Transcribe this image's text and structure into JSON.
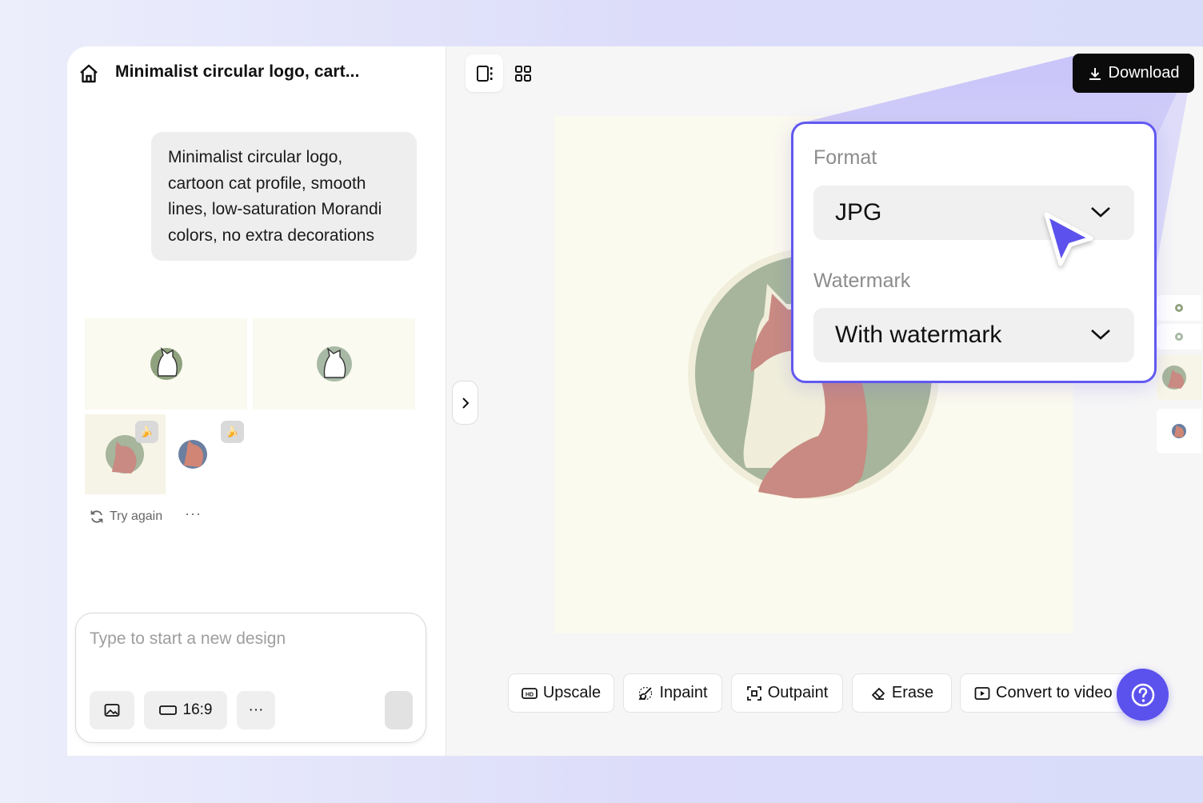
{
  "header": {
    "title": "Minimalist circular logo, cart..."
  },
  "chat": {
    "prompt": "Minimalist circular logo, cartoon cat profile, smooth lines, low-saturation Morandi colors, no extra decorations",
    "retry_label": "Try again",
    "more_label": "···",
    "thumbnails": [
      "cat-logo-green-1",
      "cat-logo-green-2",
      "cat-logo-red-1",
      "cat-logo-red-2"
    ]
  },
  "composer": {
    "placeholder": "Type to start a new design",
    "ratio_label": "16:9",
    "more_label": "···"
  },
  "toolbar": {
    "download_label": "Download"
  },
  "tools": {
    "upscale": "Upscale",
    "inpaint": "Inpaint",
    "outpaint": "Outpaint",
    "erase": "Erase",
    "convert": "Convert to video"
  },
  "popover": {
    "format_label": "Format",
    "format_value": "JPG",
    "watermark_label": "Watermark",
    "watermark_value": "With watermark"
  },
  "colors": {
    "accent": "#5b51ec",
    "logo_green": "#a6b59c",
    "logo_red": "#c88a82",
    "canvas_bg": "#fbfaee"
  }
}
